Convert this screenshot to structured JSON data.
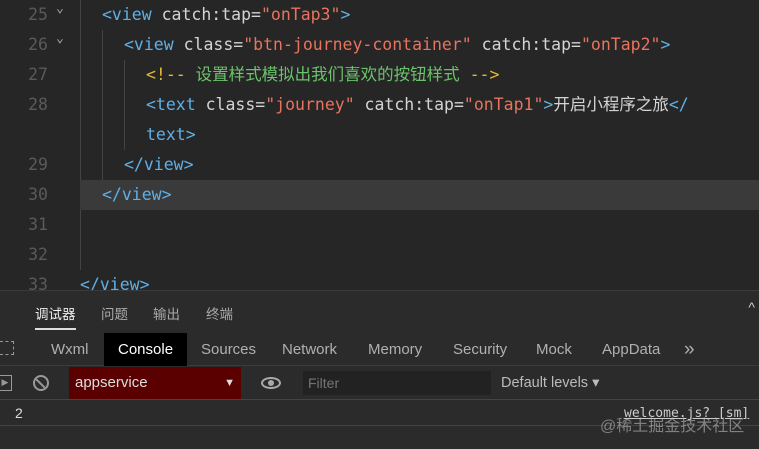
{
  "editor": {
    "lines": [
      {
        "n": "25",
        "fold": true,
        "indent": 1,
        "parts": [
          [
            "tag",
            "<view "
          ],
          [
            "attr",
            "catch:tap="
          ],
          [
            "str",
            "\"onTap3\""
          ],
          [
            "tag",
            ">"
          ]
        ]
      },
      {
        "n": "26",
        "fold": true,
        "indent": 2,
        "parts": [
          [
            "tag",
            "<view "
          ],
          [
            "attr",
            "class="
          ],
          [
            "str",
            "\"btn-journey-container\""
          ],
          [
            "attr",
            " catch:tap="
          ],
          [
            "str",
            "\"onTap2\""
          ],
          [
            "tag",
            ">"
          ]
        ]
      },
      {
        "n": "27",
        "indent": 3,
        "parts": [
          [
            "cmd",
            "<!-- "
          ],
          [
            "cm",
            "设置样式模拟出我们喜欢的按钮样式"
          ],
          [
            "cmd",
            " -->"
          ]
        ]
      },
      {
        "n": "28",
        "indent": 3,
        "parts": [
          [
            "tag",
            "<text "
          ],
          [
            "attr",
            "class="
          ],
          [
            "str",
            "\"journey\""
          ],
          [
            "attr",
            " catch:tap="
          ],
          [
            "str",
            "\"onTap1\""
          ],
          [
            "tag",
            ">"
          ],
          [
            "txt",
            "开启小程序之旅"
          ],
          [
            "tag",
            "</"
          ]
        ]
      },
      {
        "n": "",
        "indent": 3,
        "parts": [
          [
            "tag",
            "text>"
          ]
        ]
      },
      {
        "n": "29",
        "indent": 2,
        "parts": [
          [
            "tag",
            "</view>"
          ]
        ]
      },
      {
        "n": "30",
        "indent": 1,
        "current": true,
        "parts": [
          [
            "tag",
            "</view>"
          ]
        ]
      },
      {
        "n": "31",
        "indent": 0,
        "parts": []
      },
      {
        "n": "32",
        "indent": 0,
        "parts": []
      },
      {
        "n": "33",
        "indent": 0,
        "parts": [
          [
            "tag",
            "</view>"
          ]
        ]
      }
    ]
  },
  "panel_tabs": [
    "调试器",
    "问题",
    "输出",
    "终端"
  ],
  "devtools_tabs": [
    "Wxml",
    "Console",
    "Sources",
    "Network",
    "Memory",
    "Security",
    "Mock",
    "AppData"
  ],
  "active_devtools_tab": "Console",
  "more_tabs": "»",
  "toolbar": {
    "context": "appservice",
    "filter_placeholder": "Filter",
    "levels": "Default levels ▾"
  },
  "console": {
    "output": "2",
    "source": "welcome.js? [sm]"
  },
  "watermark": "@稀土掘金技术社区"
}
